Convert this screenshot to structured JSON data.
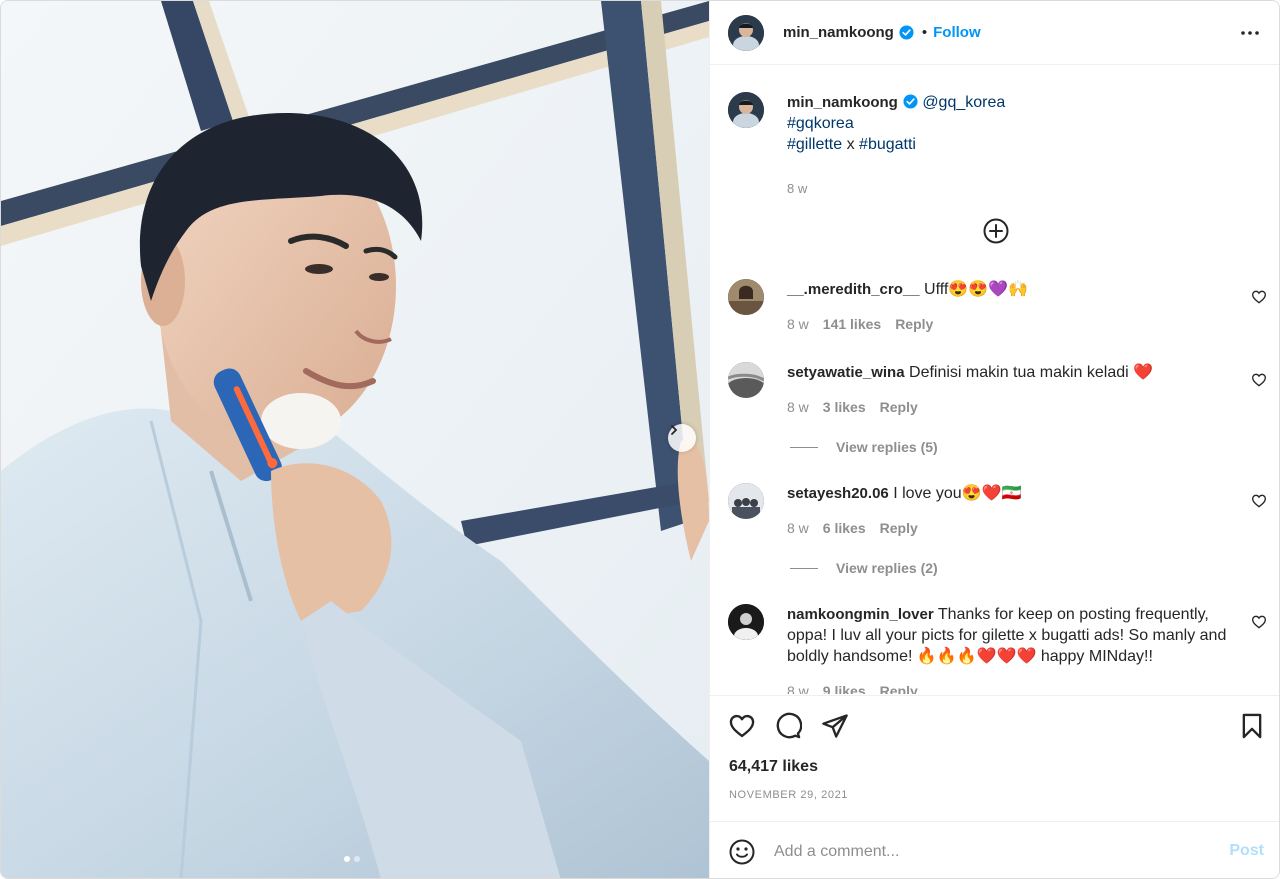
{
  "post": {
    "author": "min_namkoong",
    "follow_label": "Follow",
    "separator": "•",
    "image_dots": [
      true,
      false
    ]
  },
  "caption": {
    "mention": "@gq_korea",
    "tag_line1": "#gqkorea",
    "tag_a": "#gillette",
    "joiner": " x ",
    "tag_b": "#bugatti",
    "time": "8 w"
  },
  "comments": [
    {
      "user": "__.meredith_cro__",
      "text": "Ufff😍😍💜🙌",
      "time": "8 w",
      "likes": "141 likes",
      "reply": "Reply"
    },
    {
      "user": "setyawatie_wina",
      "text": "Definisi makin tua makin keladi ❤️",
      "time": "8 w",
      "likes": "3 likes",
      "reply": "Reply",
      "view_replies": "View replies (5)"
    },
    {
      "user": "setayesh20.06",
      "text": "I love you😍❤️🇮🇷",
      "time": "8 w",
      "likes": "6 likes",
      "reply": "Reply",
      "view_replies": "View replies (2)"
    },
    {
      "user": "namkoongmin_lover",
      "text": "Thanks for keep on posting frequently, oppa! I luv all your picts for gilette x bugatti ads! So manly and boldly handsome! 🔥🔥🔥❤️❤️❤️ happy MINday!!",
      "time": "8 w",
      "likes": "9 likes",
      "reply": "Reply"
    }
  ],
  "stats": {
    "likes": "64,417 likes",
    "date": "NOVEMBER 29, 2021"
  },
  "composer": {
    "placeholder": "Add a comment...",
    "post_label": "Post"
  },
  "colors": {
    "accent": "#0095f6",
    "hashtag": "#00376b",
    "muted": "#8e8e8e",
    "post_disabled": "#b2dffc"
  }
}
